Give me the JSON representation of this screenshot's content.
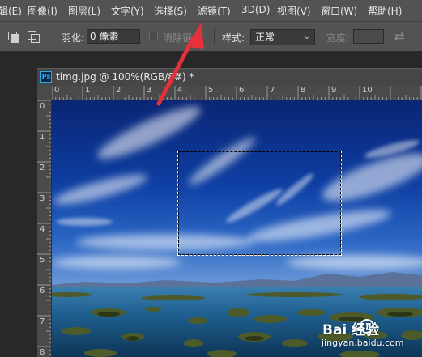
{
  "menu": {
    "items": [
      "编辑(E)",
      "图像(I)",
      "图层(L)",
      "文字(Y)",
      "选择(S)",
      "滤镜(T)",
      "3D(D)",
      "视图(V)",
      "窗口(W)",
      "帮助(H)"
    ],
    "partial_first": "辑(E)"
  },
  "options": {
    "feather_label": "羽化:",
    "feather_value": "0 像素",
    "antialias_label": "消除锯齿",
    "style_label": "样式:",
    "style_value": "正常",
    "width_label": "宽度:"
  },
  "document": {
    "title": "timg.jpg @ 100%(RGB/8#) *",
    "badge": "Ps"
  },
  "rulers": {
    "top": [
      "0",
      "1",
      "2",
      "3",
      "4",
      "5",
      "6",
      "7",
      "8",
      "9",
      "10"
    ],
    "left": [
      "0",
      "1",
      "2",
      "3",
      "4",
      "5",
      "6",
      "7",
      "8"
    ]
  },
  "watermark": {
    "brand": "Bai 经验",
    "url": "jingyan.baidu.com"
  },
  "colors": {
    "ui_dark": "#535353",
    "workspace": "#282828",
    "arrow": "#e8303a",
    "sky_deep": "#0b2f86",
    "water": "#1e5d88"
  }
}
